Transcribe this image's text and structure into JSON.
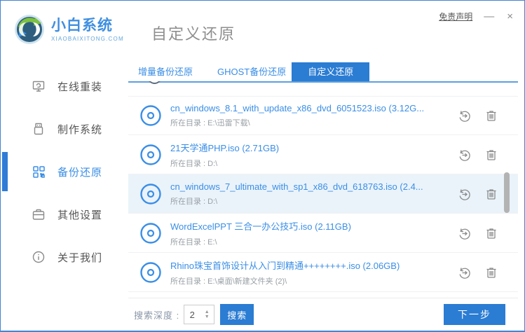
{
  "window": {
    "disclaimer": "免责声明",
    "minimize_glyph": "—",
    "close_glyph": "×"
  },
  "brand": {
    "name": "小白系统",
    "domain": "XIAOBAIXITONG.COM"
  },
  "page_title": "自定义还原",
  "sidebar": {
    "items": [
      {
        "label": "在线重装",
        "icon": "monitor-icon",
        "active": false
      },
      {
        "label": "制作系统",
        "icon": "usb-icon",
        "active": false
      },
      {
        "label": "备份还原",
        "icon": "grid-icon",
        "active": true
      },
      {
        "label": "其他设置",
        "icon": "briefcase-icon",
        "active": false
      },
      {
        "label": "关于我们",
        "icon": "info-icon",
        "active": false
      }
    ]
  },
  "tabs": [
    {
      "label": "增量备份还原",
      "active": false
    },
    {
      "label": "GHOST备份还原",
      "active": false
    },
    {
      "label": "自定义还原",
      "active": true
    }
  ],
  "list": {
    "items": [
      {
        "title": "cn_windows_8.1_with_update_x86_dvd_6051523.iso (3.12G...",
        "subtitle": "所在目录 : E:\\迅雷下载\\",
        "highlighted": false
      },
      {
        "title": "21天学通PHP.iso (2.71GB)",
        "subtitle": "所在目录 : D:\\",
        "highlighted": false
      },
      {
        "title": "cn_windows_7_ultimate_with_sp1_x86_dvd_618763.iso (2.4...",
        "subtitle": "所在目录 : D:\\",
        "highlighted": true
      },
      {
        "title": "WordExcelPPT 三合一办公技巧.iso (2.11GB)",
        "subtitle": "所在目录 : E:\\",
        "highlighted": false
      },
      {
        "title": "Rhino珠宝首饰设计从入门到精通++++++++.iso (2.06GB)",
        "subtitle": "所在目录 : E:\\桌面\\新建文件夹 (2)\\",
        "highlighted": false
      }
    ]
  },
  "footer": {
    "depth_label": "搜索深度 :",
    "depth_value": "2",
    "search_button": "搜索",
    "next_button": "下一步"
  },
  "colors": {
    "accent_fill": "#2b7cd3",
    "link_blue": "#3a8ee6",
    "highlight_row": "#eaf3fa",
    "window_border": "#4285d2"
  }
}
